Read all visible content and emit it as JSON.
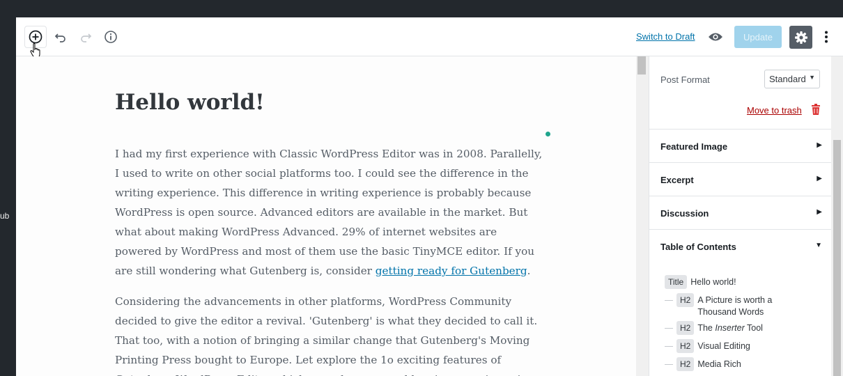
{
  "side_text": "ub",
  "toolbar": {
    "add_icon": "plus-circle-icon",
    "undo_icon": "undo-icon",
    "redo_icon": "redo-icon",
    "info_icon": "info-icon",
    "switch_to_draft": "Switch to Draft",
    "preview_icon": "eye-icon",
    "update_label": "Update",
    "settings_icon": "gear-icon",
    "more_icon": "more-vertical-icon"
  },
  "post": {
    "title": "Hello world!",
    "p1_text": "I had my first experience with Classic WordPress Editor was in 2008. Parallelly, I used to write on other social platforms too. I could see the difference in the writing experience. This difference in writing experience is probably because WordPress is open source. Advanced editors are available in the market. But what about making WordPress Advanced. 29% of internet websites are powered by WordPress and most of them use the basic TinyMCE editor. If you are still wondering what Gutenberg is, consider ",
    "p1_link": "getting ready for Gutenberg",
    "p1_end": ".",
    "p2_text": "Considering the advancements in other platforms, WordPress Community decided to give the editor a revival. 'Gutenberg' is what they decided to call it. That too, with a notion of bringing a similar change that Gutenberg's Moving Printing Press bought to Europe. Let explore the 1o exciting features of Gutenberg WordPress Editor which may change your blogging experience in a"
  },
  "sidebar": {
    "post_format_label": "Post Format",
    "post_format_value": "Standard",
    "move_to_trash": "Move to trash",
    "panels": [
      {
        "title": "Featured Image",
        "arrow": "▶"
      },
      {
        "title": "Excerpt",
        "arrow": "▶"
      },
      {
        "title": "Discussion",
        "arrow": "▶"
      },
      {
        "title": "Table of Contents",
        "arrow": "▼"
      }
    ],
    "toc": [
      {
        "badge": "Title",
        "text": "Hello world!"
      },
      {
        "badge": "H2",
        "text": "A Picture is worth a Thousand Words"
      },
      {
        "badge": "H2",
        "text": "The Inserter Tool"
      },
      {
        "badge": "H2",
        "text": "Visual Editing"
      },
      {
        "badge": "H2",
        "text": "Media Rich"
      }
    ]
  },
  "colors": {
    "accent": "#0073aa",
    "update_disabled": "#a0d3ec",
    "trash": "#dc3232",
    "settings_bg": "#555d66"
  }
}
